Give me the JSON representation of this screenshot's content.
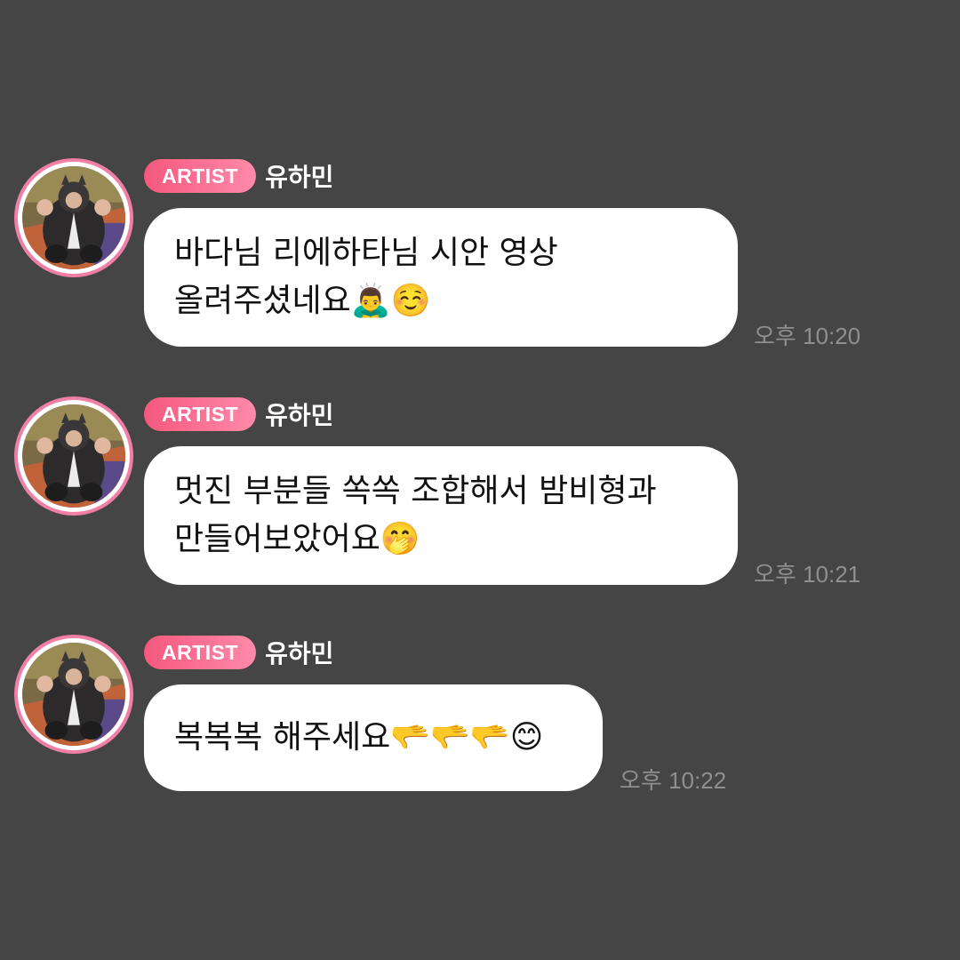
{
  "messages": [
    {
      "badge": "ARTIST",
      "name": "유하민",
      "lines": [
        "바다님 리에하타님 시안 영상",
        "올려주셨네요🙇‍♂️☺️"
      ],
      "time": "오후 10:20"
    },
    {
      "badge": "ARTIST",
      "name": "유하민",
      "lines": [
        "멋진 부분들 쏙쏙 조합해서 밤비형과",
        "만들어보았어요🤭"
      ],
      "time": "오후 10:21"
    },
    {
      "badge": "ARTIST",
      "name": "유하민",
      "lines": [
        "복복복 해주세요🫳🫳🫳😊"
      ],
      "time": "오후 10:22"
    }
  ],
  "colors": {
    "background": "#454545",
    "badge_start": "#f5587e",
    "badge_end": "#ff8aa9",
    "avatar_ring": "#ef7fa6",
    "timestamp": "#8f8f8f"
  }
}
